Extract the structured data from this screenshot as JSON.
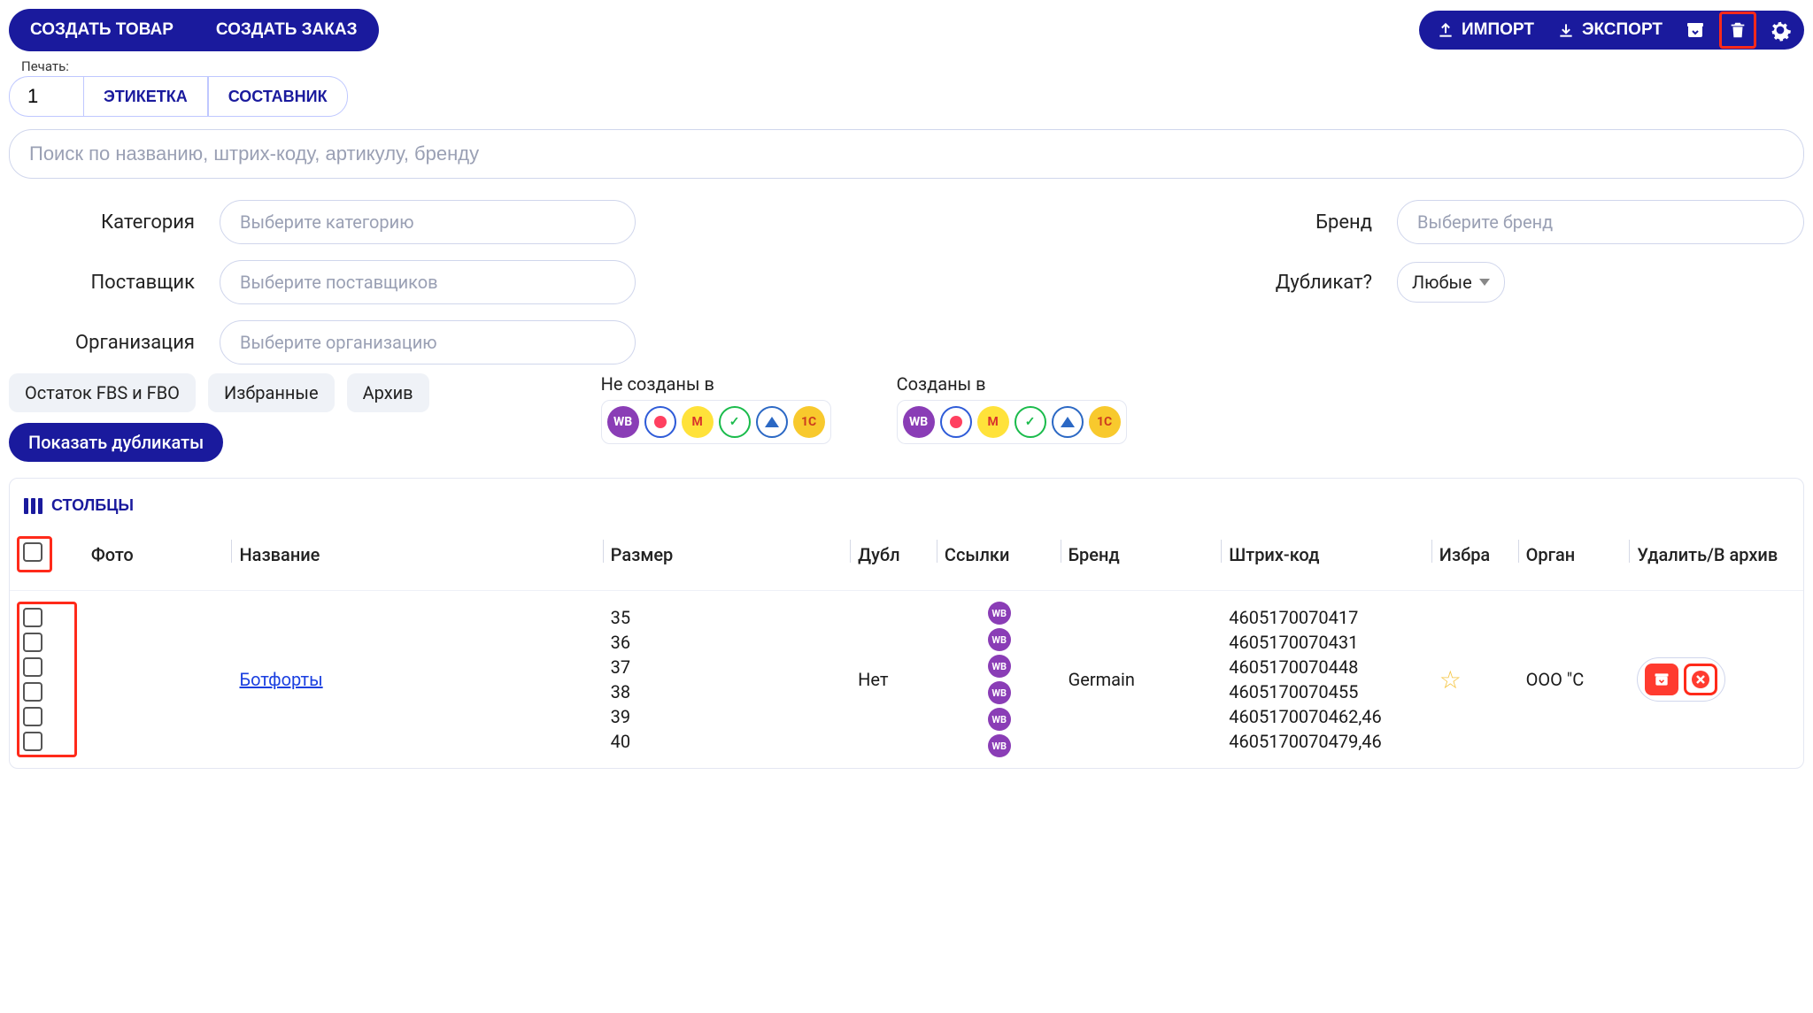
{
  "topbar": {
    "create_product": "СОЗДАТЬ ТОВАР",
    "create_order": "СОЗДАТЬ ЗАКАЗ",
    "import": "ИМПОРТ",
    "export": "ЭКСПОРТ"
  },
  "print": {
    "label": "Печать:",
    "qty": "1",
    "etiketka": "ЭТИКЕТКА",
    "sostavnik": "СОСТАВНИК"
  },
  "search": {
    "placeholder": "Поиск по названию, штрих-коду, артикулу, бренду"
  },
  "filters": {
    "category_label": "Категория",
    "category_ph": "Выберите категорию",
    "supplier_label": "Поставщик",
    "supplier_ph": "Выберите поставщиков",
    "org_label": "Организация",
    "org_ph": "Выберите организацию",
    "brand_label": "Бренд",
    "brand_ph": "Выберите бренд",
    "dup_label": "Дубликат?",
    "dup_value": "Любые"
  },
  "chips": {
    "remain": "Остаток FBS и FBO",
    "fav": "Избранные",
    "archive": "Архив",
    "show_dups": "Показать дубликаты"
  },
  "marketplaces": {
    "not_created_label": "Не созданы в",
    "created_label": "Созданы в"
  },
  "table": {
    "columns_btn": "СТОЛБЦЫ",
    "headers": {
      "photo": "Фото",
      "name": "Название",
      "size": "Размер",
      "dup": "Дубл",
      "links": "Ссылки",
      "brand": "Бренд",
      "barcode": "Штрих-код",
      "fav": "Избра",
      "org": "Орган",
      "delete": "Удалить/В архив"
    },
    "row": {
      "name": "Ботфорты",
      "sizes": [
        "35",
        "36",
        "37",
        "38",
        "39",
        "40"
      ],
      "dup": "Нет",
      "brand": "Germain",
      "barcodes": [
        "4605170070417",
        "4605170070431",
        "4605170070448",
        "4605170070455",
        "4605170070462,46",
        "4605170070479,46"
      ],
      "org": "ООО \"С"
    }
  }
}
